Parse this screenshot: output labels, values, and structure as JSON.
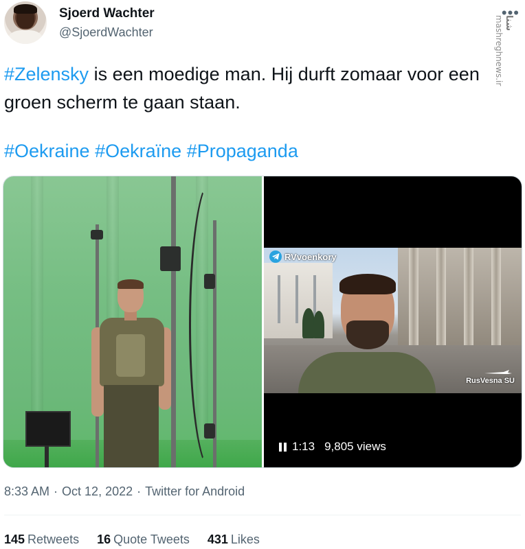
{
  "author": {
    "display_name": "Sjoerd Wachter",
    "handle": "@SjoerdWachter"
  },
  "more_icon": "more-horizontal-icon",
  "watermark": {
    "logo_text": "شنا",
    "site_text": "mashreghnews.ir"
  },
  "tweet": {
    "hashtag_1": "#Zelensky",
    "text_1": " is een moedige man. Hij durft zomaar voor een groen scherm te gaan staan.",
    "hashtags": [
      "#Oekraine",
      "#Oekraïne",
      "#Propaganda"
    ]
  },
  "media": {
    "video": {
      "channel_label": "RVvoenkory",
      "channel_icon": "telegram-icon",
      "corner_watermark": "RusVesna SU",
      "duration": "1:13",
      "views": "9,805 views"
    }
  },
  "meta": {
    "time": "8:33 AM",
    "date": "Oct 12, 2022",
    "source": "Twitter for Android",
    "separator": "·"
  },
  "stats": {
    "retweets_count": "145",
    "retweets_label": "Retweets",
    "quote_count": "16",
    "quote_label": "Quote Tweets",
    "likes_count": "431",
    "likes_label": "Likes"
  },
  "colors": {
    "link": "#1d9bf0",
    "secondary_text": "#536471",
    "primary_text": "#0f1419"
  }
}
